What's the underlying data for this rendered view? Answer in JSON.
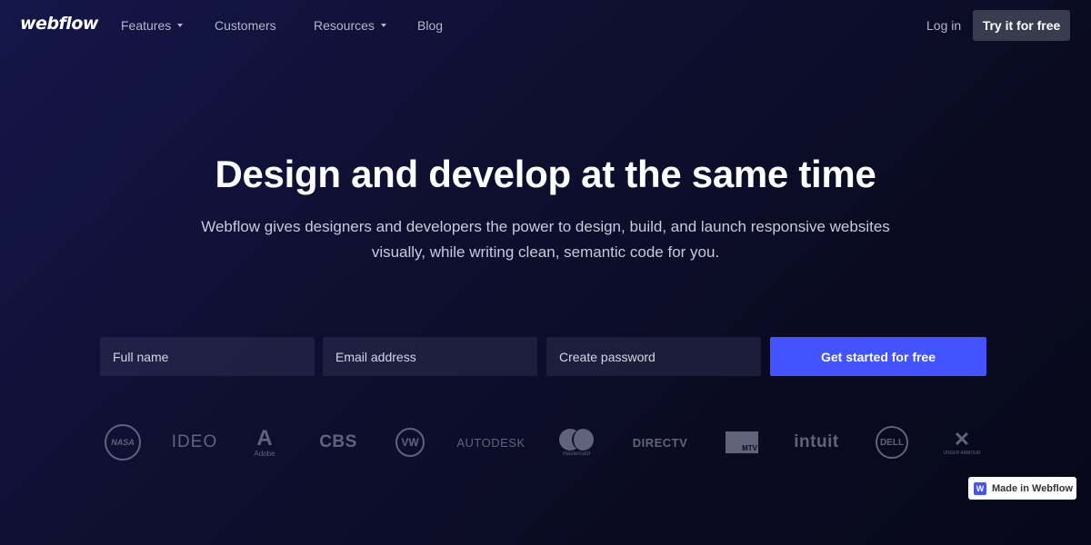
{
  "nav": {
    "logo": "webflow",
    "items": [
      {
        "label": "Features",
        "has_dropdown": true
      },
      {
        "label": "Customers",
        "has_dropdown": false
      },
      {
        "label": "Resources",
        "has_dropdown": true
      },
      {
        "label": "Blog",
        "has_dropdown": false
      }
    ],
    "login": "Log in",
    "try_button": "Try it for free"
  },
  "hero": {
    "title": "Design and develop at the same time",
    "subtitle": "Webflow gives designers and developers the power to design, build, and launch responsive websites visually, while writing clean, semantic code for you."
  },
  "signup_form": {
    "fields": [
      {
        "placeholder": "Full name",
        "value": ""
      },
      {
        "placeholder": "Email address",
        "value": ""
      },
      {
        "placeholder": "Create password",
        "value": ""
      }
    ],
    "submit": "Get started for free"
  },
  "customer_logos": [
    {
      "name": "NASA",
      "text": "NASA"
    },
    {
      "name": "IDEO",
      "text": "IDEO"
    },
    {
      "name": "Adobe",
      "text": "Adobe"
    },
    {
      "name": "CBS",
      "text": "CBS"
    },
    {
      "name": "Volkswagen",
      "text": "VW"
    },
    {
      "name": "Autodesk",
      "text": "AUTODESK"
    },
    {
      "name": "Mastercard",
      "text": "mastercard"
    },
    {
      "name": "DirecTV",
      "text": "DIRECTV"
    },
    {
      "name": "MTV",
      "text": "MTV"
    },
    {
      "name": "Intuit",
      "text": "intuit"
    },
    {
      "name": "Dell",
      "text": "DELL"
    },
    {
      "name": "Under Armour",
      "text": "UNDER ARMOUR"
    }
  ],
  "badge": {
    "icon": "W",
    "label": "Made in Webflow"
  },
  "colors": {
    "accent": "#4353ff",
    "background": "#0f1033",
    "nav_text": "#b4b6cc",
    "try_button_bg": "#393b4f"
  }
}
